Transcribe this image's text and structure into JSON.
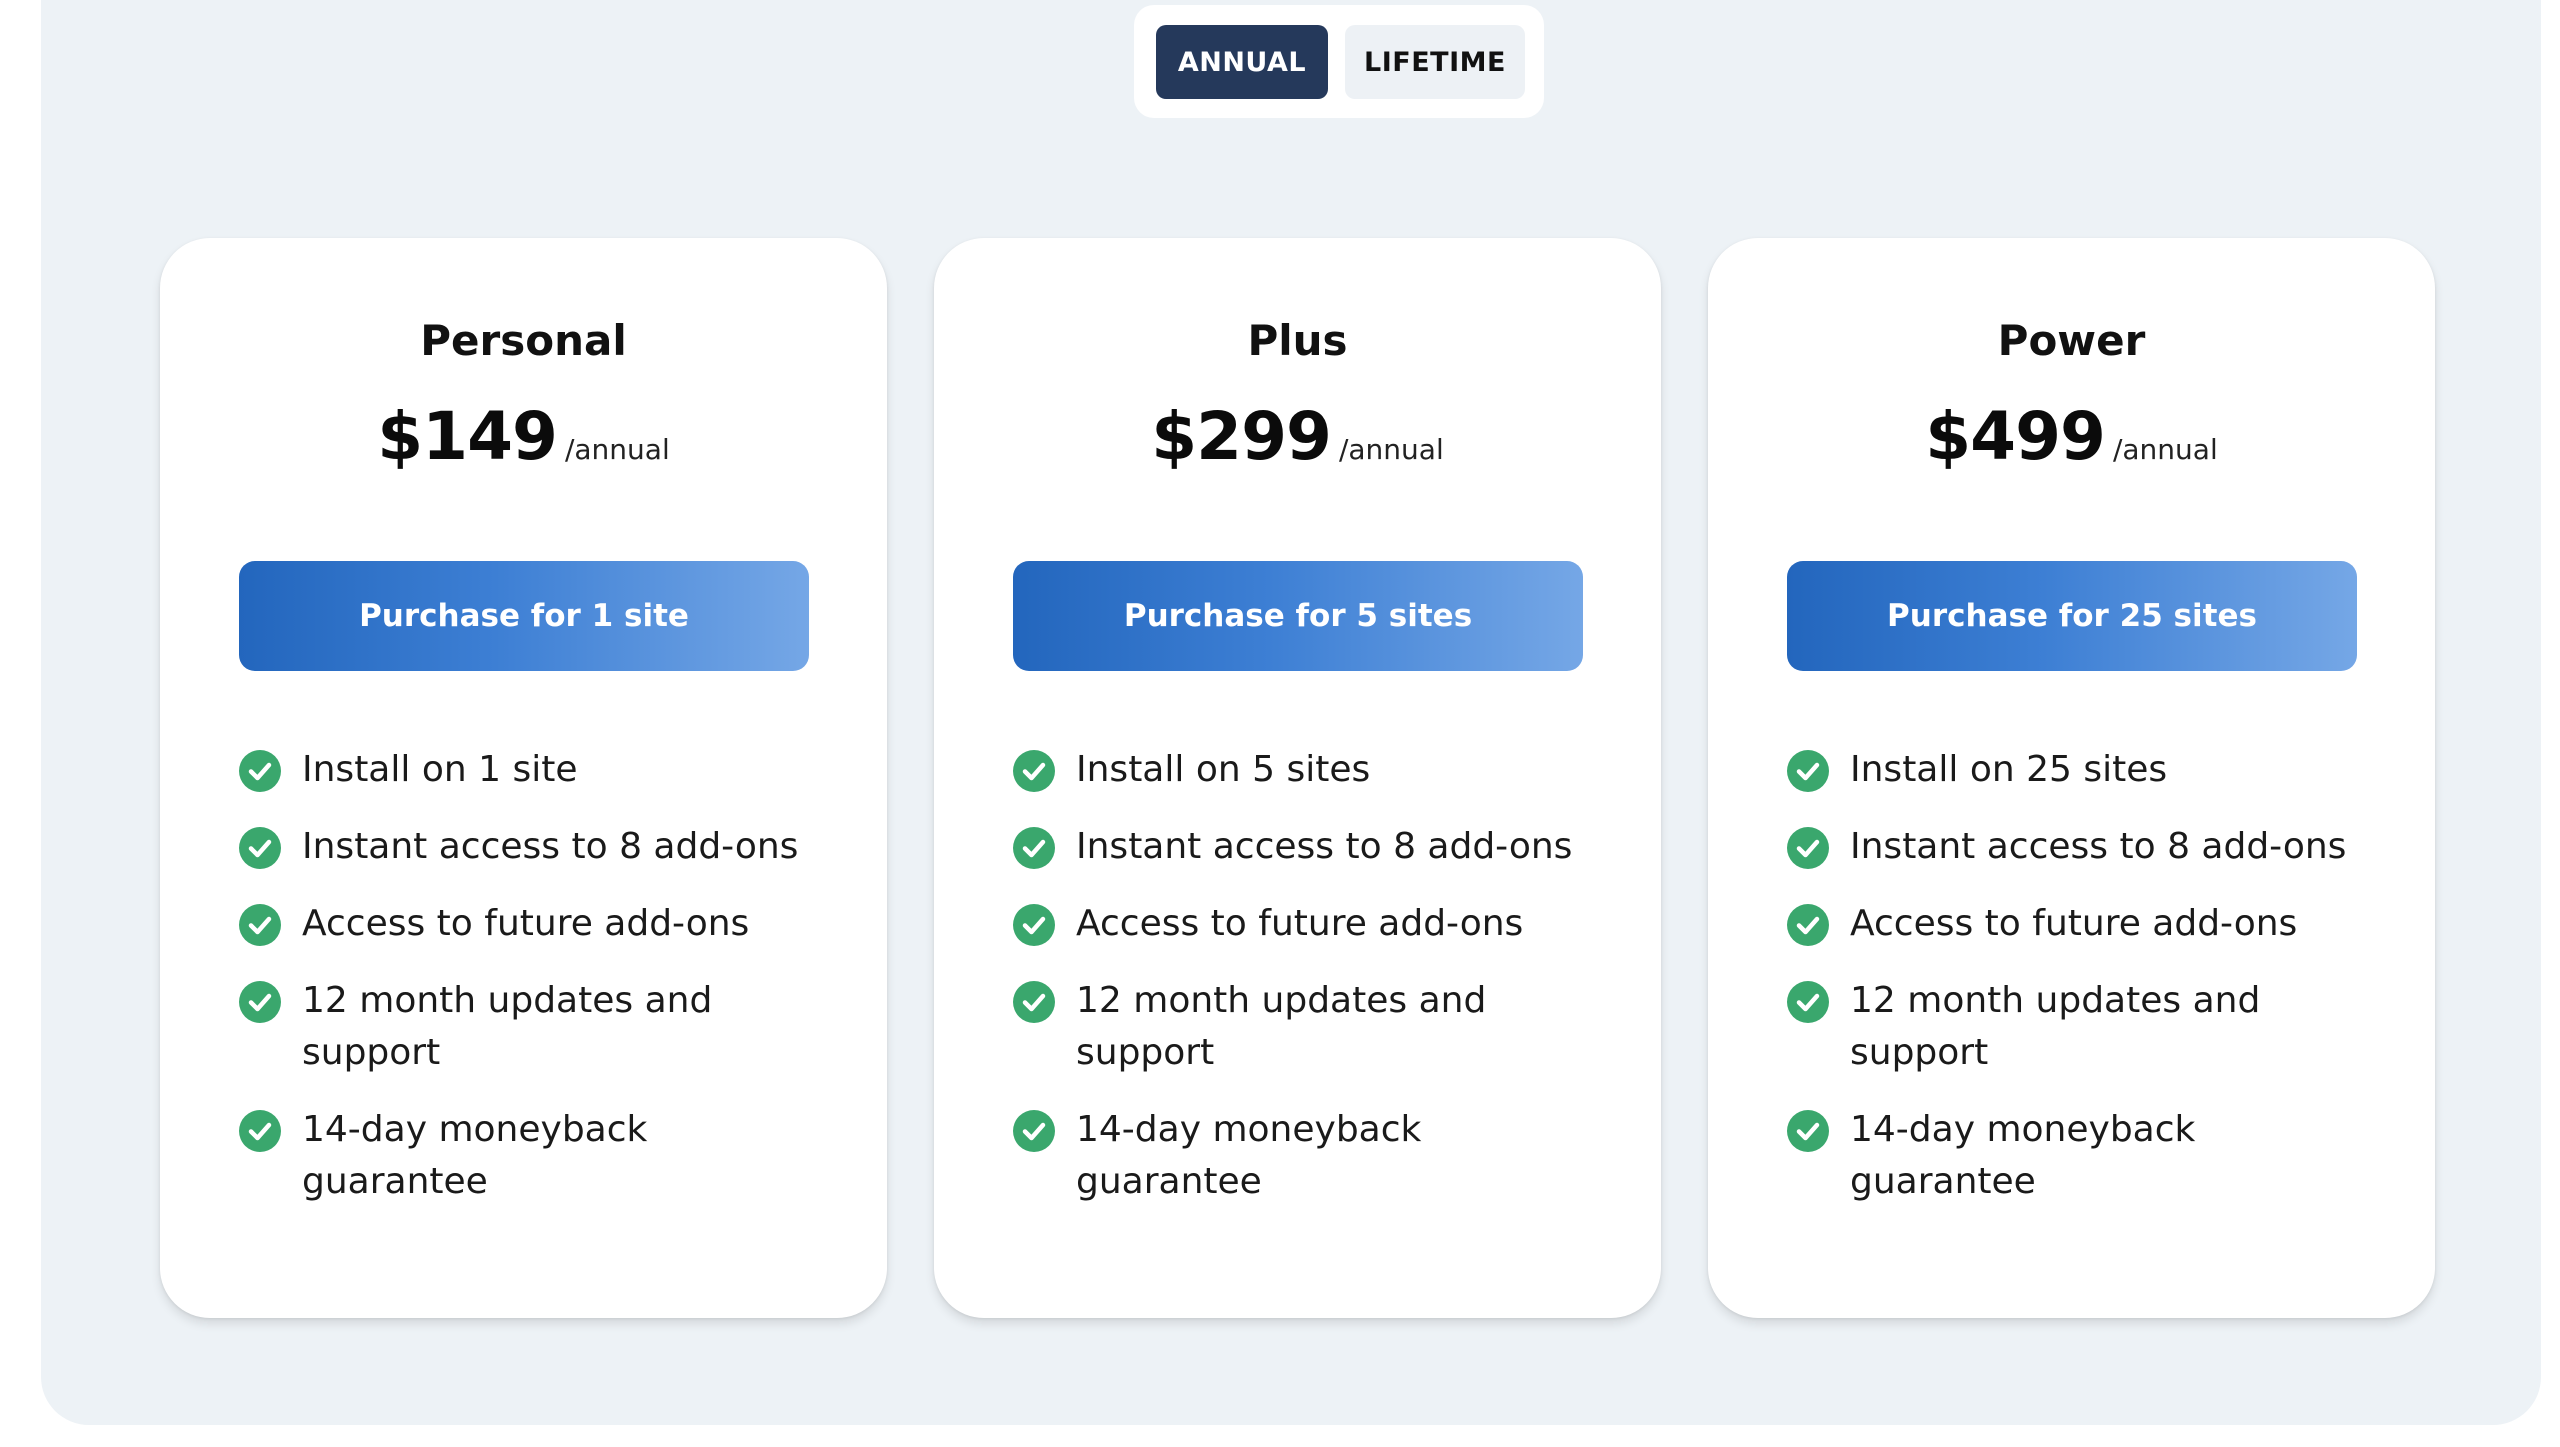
{
  "toggle": {
    "options": [
      {
        "label": "ANNUAL",
        "selected": true
      },
      {
        "label": "LIFETIME",
        "selected": false
      }
    ]
  },
  "plans": [
    {
      "name": "Personal",
      "price": "$149",
      "period": "/annual",
      "button_label": "Purchase for 1 site",
      "features": [
        "Install on 1 site",
        "Instant access to 8 add-ons",
        "Access to future add-ons",
        "12 month updates and support",
        "14-day moneyback guarantee"
      ]
    },
    {
      "name": "Plus",
      "price": "$299",
      "period": "/annual",
      "button_label": "Purchase for 5 sites",
      "features": [
        "Install on 5 sites",
        "Instant access to 8 add-ons",
        "Access to future add-ons",
        "12 month updates and support",
        "14-day moneyback guarantee"
      ]
    },
    {
      "name": "Power",
      "price": "$499",
      "period": "/annual",
      "button_label": "Purchase for 25 sites",
      "features": [
        "Install on 25 sites",
        "Instant access to 8 add-ons",
        "Access to future add-ons",
        "12 month updates and support",
        "14-day moneyback guarantee"
      ]
    }
  ],
  "icons": {
    "feature": "check-circle-icon"
  },
  "colors": {
    "toggle_active": "#25395b",
    "toggle_inactive": "#edf1f5",
    "button_gradient_start": "#2366bd",
    "button_gradient_end": "#75a7e6",
    "check_green": "#3aa76d",
    "panel_background": "#edf2f6"
  }
}
